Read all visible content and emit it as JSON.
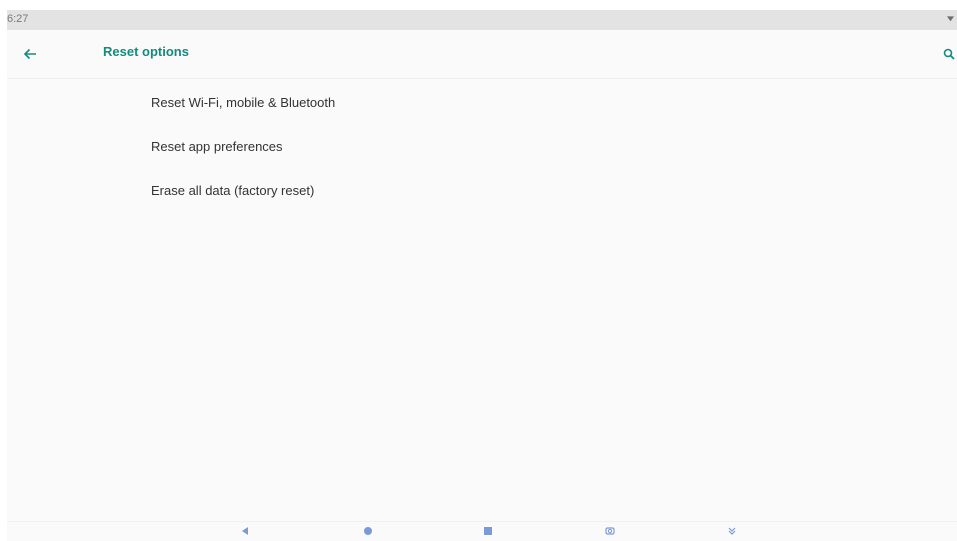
{
  "status_bar": {
    "time": "6:27"
  },
  "app_bar": {
    "title": "Reset options",
    "back_icon": "arrow-back-icon",
    "search_icon": "search-icon"
  },
  "options": [
    {
      "label": "Reset Wi-Fi, mobile & Bluetooth"
    },
    {
      "label": "Reset app preferences"
    },
    {
      "label": "Erase all data (factory reset)"
    }
  ],
  "nav_bar": {
    "buttons": [
      "back-triangle-icon",
      "home-circle-icon",
      "recents-square-icon",
      "screenshot-icon",
      "hide-nav-icon"
    ]
  },
  "colors": {
    "accent": "#148c7c",
    "nav_icon": "#7b9bd8",
    "background": "#fafafa"
  }
}
